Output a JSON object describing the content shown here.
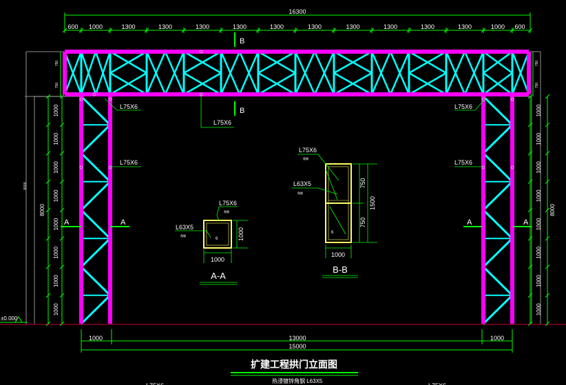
{
  "drawing": {
    "title": "扩建工程拱门立面图",
    "subtitle": "热浸镀锌角钢 L63X5",
    "colors": {
      "background": "#000000",
      "chord": "#ff00ff",
      "web": "#00ffff",
      "dimension": "#00ff00",
      "text": "#ffffff",
      "detail": "#ffff66",
      "ground": "#cc0033"
    }
  },
  "dims": {
    "overall_top": "16300",
    "top_spans": [
      "600",
      "1000",
      "1300",
      "1300",
      "1300",
      "1300",
      "1300",
      "1300",
      "1300",
      "1300",
      "1300",
      "1300",
      "1000",
      "600"
    ],
    "bottom_left": "1000",
    "bottom_mid": "13000",
    "bottom_right": "1000",
    "bottom_total": "15000",
    "left_height": "8000",
    "left_small": "8000",
    "right_height": "8000",
    "col_spacing": "1000",
    "beam_top": "750",
    "beam_bottom": "750",
    "elevation": "±0.000",
    "detail_a_w": "1000",
    "detail_a_h": "1000",
    "detail_b_w": "1000",
    "detail_b_h1": "750",
    "detail_b_h2": "750",
    "detail_b_total": "1500",
    "weld": "6"
  },
  "labels": {
    "section_a": "A",
    "section_b": "B",
    "angle_main": "L75X6",
    "angle_web": "L63X5",
    "tiny": "角钢",
    "section_aa": "A-A",
    "section_bb": "B-B"
  }
}
